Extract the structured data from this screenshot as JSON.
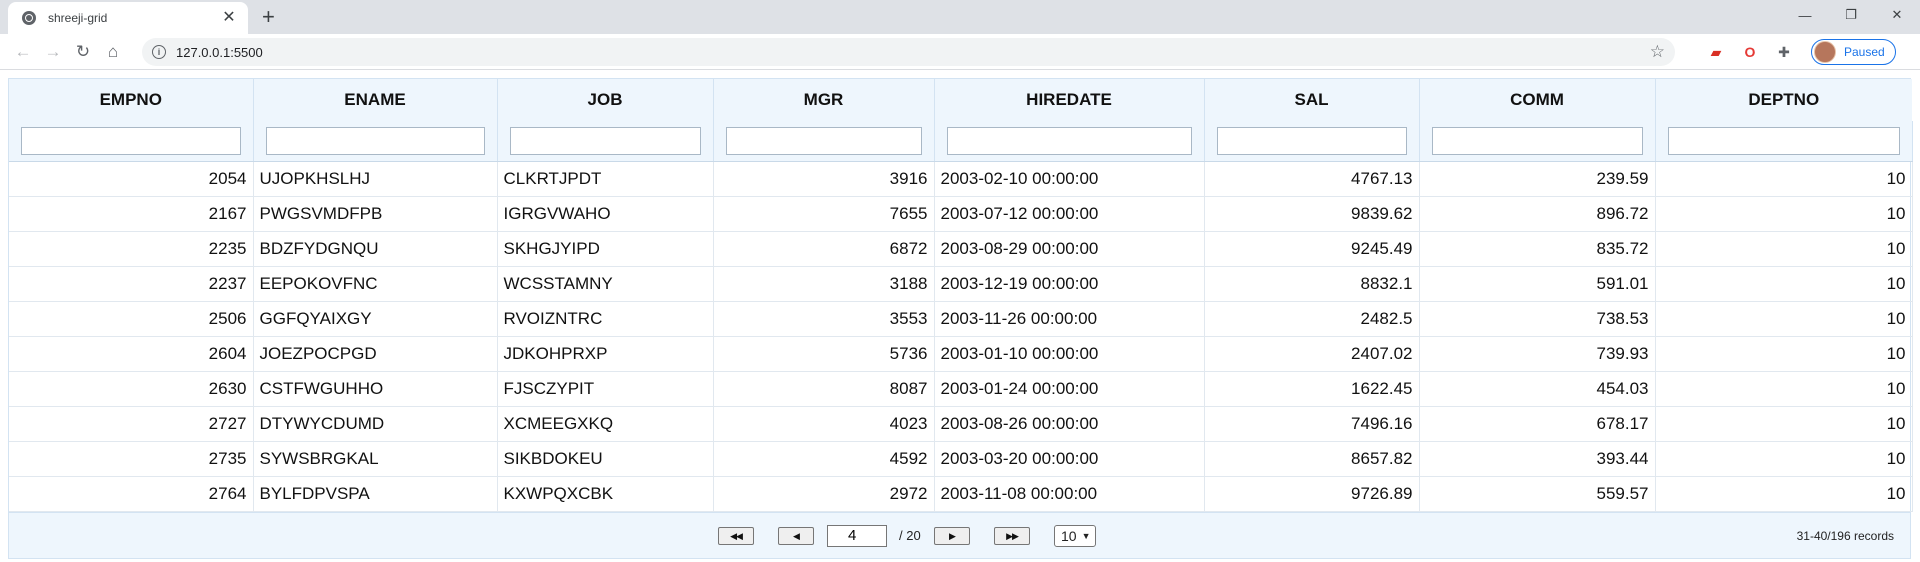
{
  "browser": {
    "tab_title": "shreeji-grid",
    "tab_close": "✕",
    "new_tab": "+",
    "url": "127.0.0.1:5500",
    "profile_status": "Paused",
    "window_controls": [
      "—",
      "❐",
      "✕"
    ]
  },
  "grid": {
    "columns": [
      {
        "key": "EMPNO",
        "label": "EMPNO",
        "align": "num"
      },
      {
        "key": "ENAME",
        "label": "ENAME",
        "align": "txt"
      },
      {
        "key": "JOB",
        "label": "JOB",
        "align": "txt"
      },
      {
        "key": "MGR",
        "label": "MGR",
        "align": "num"
      },
      {
        "key": "HIREDATE",
        "label": "HIREDATE",
        "align": "txt"
      },
      {
        "key": "SAL",
        "label": "SAL",
        "align": "num"
      },
      {
        "key": "COMM",
        "label": "COMM",
        "align": "num"
      },
      {
        "key": "DEPTNO",
        "label": "DEPTNO",
        "align": "num"
      }
    ],
    "filters": [
      "",
      "",
      "",
      "",
      "",
      "",
      "",
      ""
    ],
    "rows": [
      [
        "2054",
        "UJOPKHSLHJ",
        "CLKRTJPDT",
        "3916",
        "2003-02-10 00:00:00",
        "4767.13",
        "239.59",
        "10"
      ],
      [
        "2167",
        "PWGSVMDFPB",
        "IGRGVWAHO",
        "7655",
        "2003-07-12 00:00:00",
        "9839.62",
        "896.72",
        "10"
      ],
      [
        "2235",
        "BDZFYDGNQU",
        "SKHGJYIPD",
        "6872",
        "2003-08-29 00:00:00",
        "9245.49",
        "835.72",
        "10"
      ],
      [
        "2237",
        "EEPOKOVFNC",
        "WCSSTAMNY",
        "3188",
        "2003-12-19 00:00:00",
        "8832.1",
        "591.01",
        "10"
      ],
      [
        "2506",
        "GGFQYAIXGY",
        "RVOIZNTRC",
        "3553",
        "2003-11-26 00:00:00",
        "2482.5",
        "738.53",
        "10"
      ],
      [
        "2604",
        "JOEZPOCPGD",
        "JDKOHPRXP",
        "5736",
        "2003-01-10 00:00:00",
        "2407.02",
        "739.93",
        "10"
      ],
      [
        "2630",
        "CSTFWGUHHO",
        "FJSCZYPIT",
        "8087",
        "2003-01-24 00:00:00",
        "1622.45",
        "454.03",
        "10"
      ],
      [
        "2727",
        "DTYWYCDUMD",
        "XCMEEGXKQ",
        "4023",
        "2003-08-26 00:00:00",
        "7496.16",
        "678.17",
        "10"
      ],
      [
        "2735",
        "SYWSBRGKAL",
        "SIKBDOKEU",
        "4592",
        "2003-03-20 00:00:00",
        "8657.82",
        "393.44",
        "10"
      ],
      [
        "2764",
        "BYLFDPVSPA",
        "KXWPQXCBK",
        "2972",
        "2003-11-08 00:00:00",
        "9726.89",
        "559.57",
        "10"
      ]
    ]
  },
  "pager": {
    "first_label": "◀◀",
    "prev_label": "◀",
    "next_label": "▶",
    "last_label": "▶▶",
    "current_page": "4",
    "total_pages": "/ 20",
    "page_size": "10",
    "records": "31-40/196 records"
  }
}
